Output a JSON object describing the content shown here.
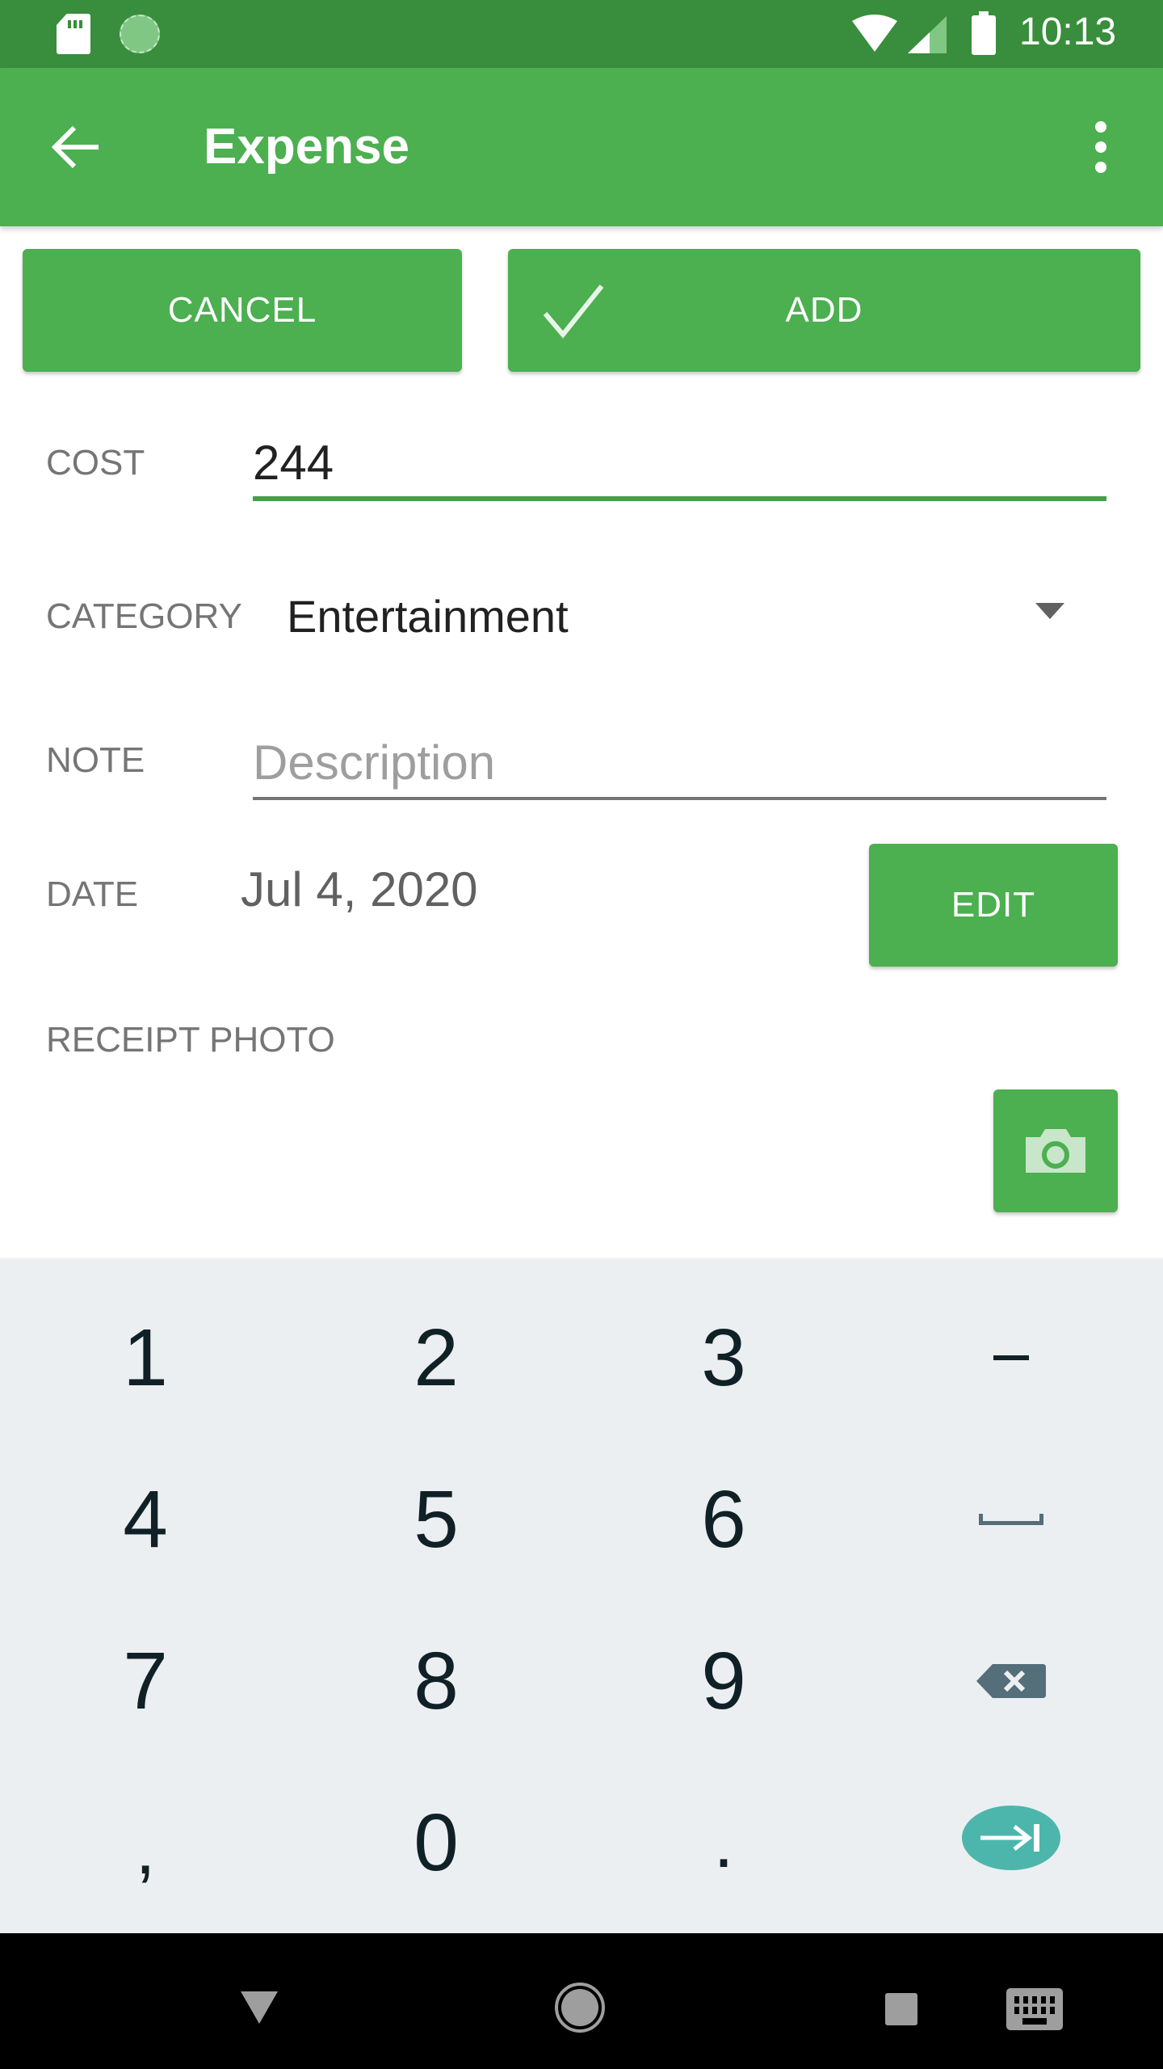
{
  "status_bar": {
    "time": "10:13",
    "icons": [
      "sd-card-icon",
      "sync-icon",
      "wifi-icon",
      "cell-signal-icon",
      "battery-icon"
    ]
  },
  "app_bar": {
    "title": "Expense",
    "back_icon": "arrow-left-icon",
    "menu_icon": "more-vert-icon"
  },
  "actions": {
    "cancel_label": "CANCEL",
    "add_label": "ADD",
    "add_icon": "check-icon"
  },
  "form": {
    "cost": {
      "label": "COST",
      "value": "244"
    },
    "category": {
      "label": "CATEGORY",
      "value": "Entertainment"
    },
    "note": {
      "label": "NOTE",
      "value": "",
      "placeholder": "Description"
    },
    "date": {
      "label": "DATE",
      "value": "Jul 4, 2020",
      "edit_label": "EDIT"
    },
    "receipt": {
      "label": "RECEIPT PHOTO",
      "camera_icon": "camera-icon"
    }
  },
  "keyboard": {
    "rows": [
      [
        "1",
        "2",
        "3",
        "–"
      ],
      [
        "4",
        "5",
        "6",
        "space"
      ],
      [
        "7",
        "8",
        "9",
        "backspace"
      ],
      [
        ",",
        "0",
        ".",
        "next"
      ]
    ]
  },
  "nav_bar": {
    "items": [
      "back",
      "home",
      "recents",
      "keyboard-switch"
    ]
  },
  "colors": {
    "primary": "#4caf50",
    "primary_dark": "#388e3c",
    "accent_teal": "#4db6ac",
    "keyboard_bg": "#eceff1"
  }
}
